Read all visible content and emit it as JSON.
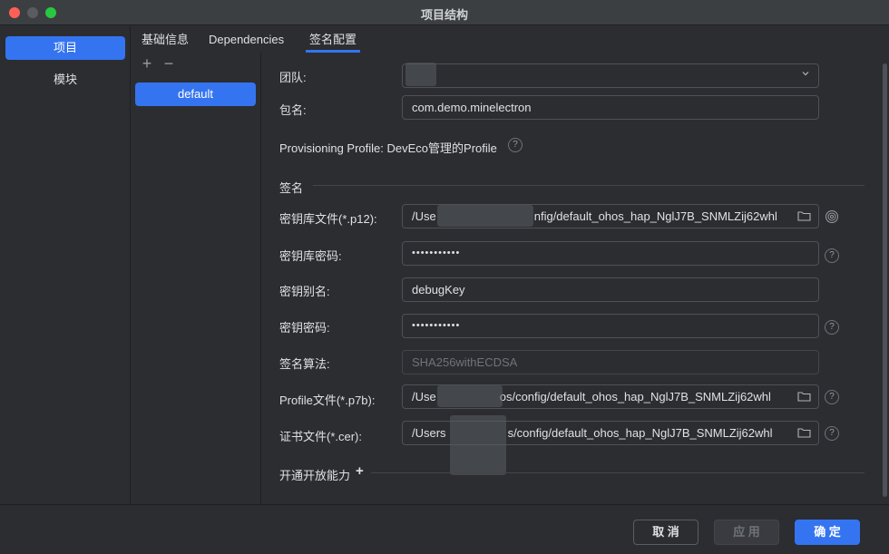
{
  "window": {
    "title": "项目结构"
  },
  "nav": {
    "items": [
      {
        "label": "项目",
        "active": true
      },
      {
        "label": "模块",
        "active": false
      }
    ]
  },
  "tabs": [
    {
      "label": "基础信息"
    },
    {
      "label": "Dependencies"
    },
    {
      "label": "签名配置",
      "active": true
    }
  ],
  "configs": {
    "add": "+",
    "remove": "−",
    "items": [
      "default"
    ]
  },
  "form": {
    "team_label": "团队:",
    "team_value": "",
    "package_label": "包名:",
    "package_value": "com.demo.minelectron",
    "provisioning": "Provisioning Profile: DevEco管理的Profile",
    "sign_section": "签名",
    "keystore_label": "密钥库文件(*.p12):",
    "keystore_value": "/Use",
    "keystore_value_tail": "nfig/default_ohos_hap_NglJ7B_SNMLZij62whl",
    "keystore_pwd_label": "密钥库密码:",
    "keystore_pwd_value": "•••••••••••",
    "alias_label": "密钥别名:",
    "alias_value": "debugKey",
    "key_pwd_label": "密钥密码:",
    "key_pwd_value": "•••••••••••",
    "algo_label": "签名算法:",
    "algo_value": "SHA256withECDSA",
    "profile_label": "Profile文件(*.p7b):",
    "profile_value": "/Use",
    "profile_value_tail": "os/config/default_ohos_hap_NglJ7B_SNMLZij62whl",
    "cert_label": "证书文件(*.cer):",
    "cert_value": "/Users",
    "cert_value_tail": "s/config/default_ohos_hap_NglJ7B_SNMLZij62whl",
    "open_caps": "开通开放能力",
    "open_caps_plus": "+"
  },
  "footer": {
    "cancel": "取 消",
    "apply": "应 用",
    "ok": "确 定"
  },
  "colors": {
    "accent": "#3574f0",
    "background": "#2b2d30"
  }
}
